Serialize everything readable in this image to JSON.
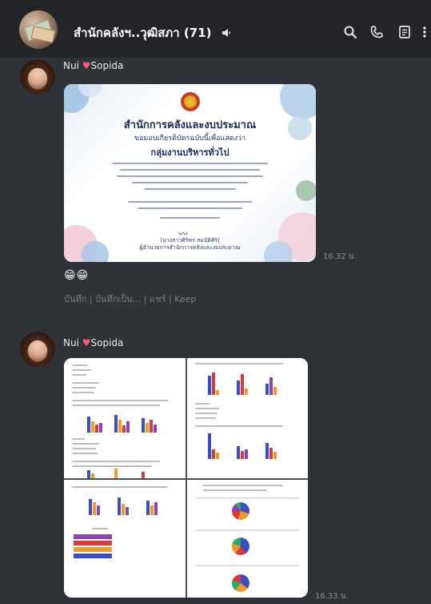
{
  "header": {
    "title": "สำนักคลังฯ..วุฒิสภา (71)",
    "icons": [
      "mute-icon",
      "search-icon",
      "phone-icon",
      "notes-icon",
      "menu-icon"
    ]
  },
  "messages": [
    {
      "sender": "Nui",
      "sender_suffix": "Sopida",
      "certificate": {
        "org": "สำนักการคลังและงบประมาณ",
        "subtitle": "ขอมอบเกียรติบัตรฉบับนี้เพื่อแสดงว่า",
        "recipient": "กลุ่มงานบริหารทั่วไป",
        "signer": "(นางสาวศิริพร สมบัติศิริ)",
        "signer_title": "ผู้อำนวยการสำนักการคลังและงบประมาณ"
      },
      "time": "16.32 น.",
      "reaction": "😁😁",
      "actions": [
        "บันทึก",
        "บันทึกเป็น...",
        "แชร์",
        "Keep"
      ]
    },
    {
      "sender": "Nui",
      "sender_suffix": "Sopida",
      "time": "16.33 น."
    }
  ],
  "colors": {
    "background": "#2f3237",
    "header": "#222428",
    "accent_heart": "#ff5a78",
    "chart_blue": "#3b4fc4",
    "chart_orange": "#f29a2e",
    "chart_red": "#d93b3b",
    "chart_purple": "#8e44ad"
  }
}
